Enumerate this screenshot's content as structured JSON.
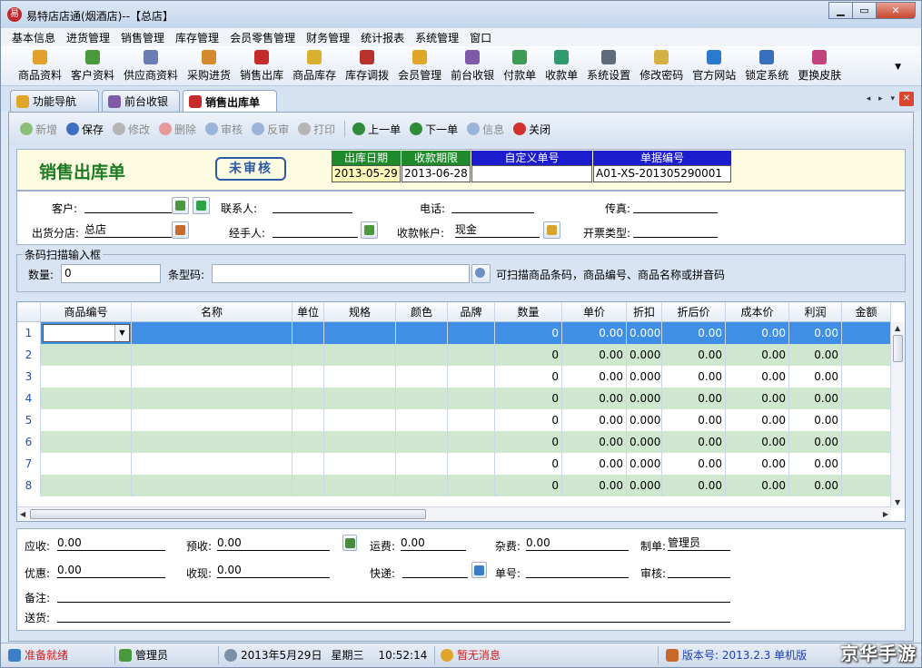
{
  "window": {
    "title": "易特店店通(烟酒店)--【总店】",
    "min": "▁",
    "max": "▭",
    "close": "✕"
  },
  "menu": [
    "基本信息",
    "进货管理",
    "销售管理",
    "库存管理",
    "会员零售管理",
    "财务管理",
    "统计报表",
    "系统管理",
    "窗口"
  ],
  "toolbar": [
    {
      "label": "商品资料",
      "icon": "goods-icon",
      "color": "#e2a12b"
    },
    {
      "label": "客户资料",
      "icon": "customer-icon",
      "color": "#4a9a3b"
    },
    {
      "label": "供应商资料",
      "icon": "supplier-icon",
      "color": "#6a7db2"
    },
    {
      "label": "采购进货",
      "icon": "purchase-icon",
      "color": "#d6892c"
    },
    {
      "label": "销售出库",
      "icon": "sales-out-icon",
      "color": "#c62b2b"
    },
    {
      "label": "商品库存",
      "icon": "stock-icon",
      "color": "#d9b12e"
    },
    {
      "label": "库存调拨",
      "icon": "transfer-icon",
      "color": "#b8332e"
    },
    {
      "label": "会员管理",
      "icon": "member-icon",
      "color": "#e0a628"
    },
    {
      "label": "前台收银",
      "icon": "cashier-icon",
      "color": "#7e5aa8"
    },
    {
      "label": "付款单",
      "icon": "payment-icon",
      "color": "#3f9a55"
    },
    {
      "label": "收款单",
      "icon": "receipt-icon",
      "color": "#2f9a6f"
    },
    {
      "label": "系统设置",
      "icon": "settings-icon",
      "color": "#5f6b7a"
    },
    {
      "label": "修改密码",
      "icon": "password-icon",
      "color": "#d4b142"
    },
    {
      "label": "官方网站",
      "icon": "website-icon",
      "color": "#2a7ad1"
    },
    {
      "label": "锁定系统",
      "icon": "lock-icon",
      "color": "#3a6fbf"
    },
    {
      "label": "更换皮肤",
      "icon": "skin-icon",
      "color": "#c2417f"
    }
  ],
  "toolbar_more": "▼",
  "tabs": [
    {
      "label": "功能导航",
      "color": "#e0a628"
    },
    {
      "label": "前台收银",
      "color": "#7e5aa8"
    },
    {
      "label": "销售出库单",
      "color": "#c62b2b"
    }
  ],
  "tabnav": "◂ ▸ ▾",
  "actions": [
    {
      "label": "新增",
      "enabled": false,
      "color": "#8bbf7a"
    },
    {
      "label": "保存",
      "enabled": true,
      "color": "#3f6fc4"
    },
    {
      "label": "修改",
      "enabled": false,
      "color": "#b5b5b5"
    },
    {
      "label": "删除",
      "enabled": false,
      "color": "#e49a9a"
    },
    {
      "label": "审核",
      "enabled": false,
      "color": "#9ab5d9"
    },
    {
      "label": "反审",
      "enabled": false,
      "color": "#9ab5d9"
    },
    {
      "label": "打印",
      "enabled": false,
      "color": "#b5b5b5"
    },
    {
      "label": "上一单",
      "enabled": true,
      "color": "#2f8c3a"
    },
    {
      "label": "下一单",
      "enabled": true,
      "color": "#2f8c3a"
    },
    {
      "label": "信息",
      "enabled": false,
      "color": "#9ab5d9"
    },
    {
      "label": "关闭",
      "enabled": true,
      "color": "#d42f2f"
    }
  ],
  "header": {
    "doc_title": "销售出库单",
    "stamp": "未审核",
    "out_date_label": "出库日期",
    "out_date": "2013-05-29",
    "due_label": "收款期限",
    "due_date": "2013-06-28",
    "custom_no_label": "自定义单号",
    "custom_no": "",
    "doc_no_label": "单据编号",
    "doc_no": "A01-XS-201305290001"
  },
  "customer": {
    "customer_label": "客户:",
    "customer": "",
    "contact_label": "联系人:",
    "contact": "",
    "phone_label": "电话:",
    "phone": "",
    "fax_label": "传真:",
    "fax": "",
    "branch_label": "出货分店:",
    "branch": "总店",
    "handler_label": "经手人:",
    "handler": "",
    "account_label": "收款帐户:",
    "account": "现金",
    "invoice_label": "开票类型:",
    "invoice": ""
  },
  "scan": {
    "legend": "条码扫描输入框",
    "qty_label": "数量:",
    "qty": "0",
    "barcode_label": "条型码:",
    "barcode": "",
    "hint": "可扫描商品条码，商品编号、商品名称或拼音码"
  },
  "grid": {
    "columns": [
      "",
      "商品编号",
      "名称",
      "单位",
      "规格",
      "颜色",
      "品牌",
      "数量",
      "单价",
      "折扣",
      "折后价",
      "成本价",
      "利润",
      "金额"
    ],
    "rows": [
      [
        "1",
        "",
        "",
        "",
        "",
        "",
        "",
        "0",
        "0.00",
        "0.000",
        "0.00",
        "0.00",
        "0.00",
        ""
      ],
      [
        "2",
        "",
        "",
        "",
        "",
        "",
        "",
        "0",
        "0.00",
        "0.000",
        "0.00",
        "0.00",
        "0.00",
        ""
      ],
      [
        "3",
        "",
        "",
        "",
        "",
        "",
        "",
        "0",
        "0.00",
        "0.000",
        "0.00",
        "0.00",
        "0.00",
        ""
      ],
      [
        "4",
        "",
        "",
        "",
        "",
        "",
        "",
        "0",
        "0.00",
        "0.000",
        "0.00",
        "0.00",
        "0.00",
        ""
      ],
      [
        "5",
        "",
        "",
        "",
        "",
        "",
        "",
        "0",
        "0.00",
        "0.000",
        "0.00",
        "0.00",
        "0.00",
        ""
      ],
      [
        "6",
        "",
        "",
        "",
        "",
        "",
        "",
        "0",
        "0.00",
        "0.000",
        "0.00",
        "0.00",
        "0.00",
        ""
      ],
      [
        "7",
        "",
        "",
        "",
        "",
        "",
        "",
        "0",
        "0.00",
        "0.000",
        "0.00",
        "0.00",
        "0.00",
        ""
      ],
      [
        "8",
        "",
        "",
        "",
        "",
        "",
        "",
        "0",
        "0.00",
        "0.000",
        "0.00",
        "0.00",
        "0.00",
        ""
      ]
    ],
    "dropdown_arrow": "▼"
  },
  "footer": {
    "receivable_label": "应收:",
    "receivable": "0.00",
    "prepaid_label": "预收:",
    "prepaid": "0.00",
    "freight_label": "运费:",
    "freight": "0.00",
    "misc_label": "杂费:",
    "misc": "0.00",
    "maker_label": "制单:",
    "maker": "管理员",
    "discount_label": "优惠:",
    "discount": "0.00",
    "cash_label": "收现:",
    "cash": "0.00",
    "express_label": "快递:",
    "express": "",
    "tracking_label": "单号:",
    "tracking": "",
    "auditor_label": "审核:",
    "auditor": "",
    "remark_label": "备注:",
    "remark": "",
    "delivery_label": "送货:",
    "delivery": ""
  },
  "status": {
    "ready": "准备就绪",
    "user": "管理员",
    "date": "2013年5月29日",
    "weekday": "星期三",
    "time": "10:52:14",
    "messages": "暂无消息",
    "version": "版本号: 2013.2.3 单机版"
  },
  "watermark": "京华手游"
}
